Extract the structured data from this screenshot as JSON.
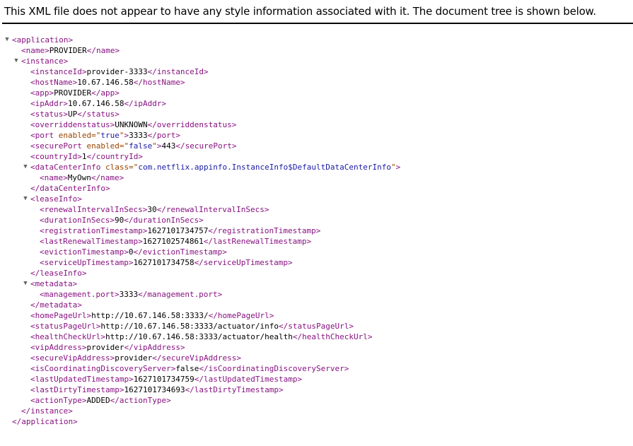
{
  "notice": "This XML file does not appear to have any style information associated with it. The document tree is shown below.",
  "toggle_glyph": "▼",
  "tree": [
    {
      "indent": 0,
      "open": "application",
      "toggle": true
    },
    {
      "indent": 1,
      "open": "name",
      "text": "PROVIDER",
      "close": "name"
    },
    {
      "indent": 1,
      "open": "instance",
      "toggle": true
    },
    {
      "indent": 2,
      "open": "instanceId",
      "text": "provider-3333",
      "close": "instanceId"
    },
    {
      "indent": 2,
      "open": "hostName",
      "text": "10.67.146.58",
      "close": "hostName"
    },
    {
      "indent": 2,
      "open": "app",
      "text": "PROVIDER",
      "close": "app"
    },
    {
      "indent": 2,
      "open": "ipAddr",
      "text": "10.67.146.58",
      "close": "ipAddr"
    },
    {
      "indent": 2,
      "open": "status",
      "text": "UP",
      "close": "status"
    },
    {
      "indent": 2,
      "open": "overriddenstatus",
      "text": "UNKNOWN",
      "close": "overriddenstatus"
    },
    {
      "indent": 2,
      "open": "port",
      "attr": {
        "name": "enabled",
        "value": "true"
      },
      "text": "3333",
      "close": "port"
    },
    {
      "indent": 2,
      "open": "securePort",
      "attr": {
        "name": "enabled",
        "value": "false"
      },
      "text": "443",
      "close": "securePort"
    },
    {
      "indent": 2,
      "open": "countryId",
      "text": "1",
      "close": "countryId"
    },
    {
      "indent": 2,
      "open": "dataCenterInfo",
      "attr": {
        "name": "class",
        "value": "com.netflix.appinfo.InstanceInfo$DefaultDataCenterInfo"
      },
      "toggle": true
    },
    {
      "indent": 3,
      "open": "name",
      "text": "MyOwn",
      "close": "name"
    },
    {
      "indent": 2,
      "close": "dataCenterInfo"
    },
    {
      "indent": 2,
      "open": "leaseInfo",
      "toggle": true
    },
    {
      "indent": 3,
      "open": "renewalIntervalInSecs",
      "text": "30",
      "close": "renewalIntervalInSecs"
    },
    {
      "indent": 3,
      "open": "durationInSecs",
      "text": "90",
      "close": "durationInSecs"
    },
    {
      "indent": 3,
      "open": "registrationTimestamp",
      "text": "1627101734757",
      "close": "registrationTimestamp"
    },
    {
      "indent": 3,
      "open": "lastRenewalTimestamp",
      "text": "1627102574861",
      "close": "lastRenewalTimestamp"
    },
    {
      "indent": 3,
      "open": "evictionTimestamp",
      "text": "0",
      "close": "evictionTimestamp"
    },
    {
      "indent": 3,
      "open": "serviceUpTimestamp",
      "text": "1627101734758",
      "close": "serviceUpTimestamp"
    },
    {
      "indent": 2,
      "close": "leaseInfo"
    },
    {
      "indent": 2,
      "open": "metadata",
      "toggle": true
    },
    {
      "indent": 3,
      "open": "management.port",
      "text": "3333",
      "close": "management.port"
    },
    {
      "indent": 2,
      "close": "metadata"
    },
    {
      "indent": 2,
      "open": "homePageUrl",
      "text": "http://10.67.146.58:3333/",
      "close": "homePageUrl"
    },
    {
      "indent": 2,
      "open": "statusPageUrl",
      "text": "http://10.67.146.58:3333/actuator/info",
      "close": "statusPageUrl"
    },
    {
      "indent": 2,
      "open": "healthCheckUrl",
      "text": "http://10.67.146.58:3333/actuator/health",
      "close": "healthCheckUrl"
    },
    {
      "indent": 2,
      "open": "vipAddress",
      "text": "provider",
      "close": "vipAddress"
    },
    {
      "indent": 2,
      "open": "secureVipAddress",
      "text": "provider",
      "close": "secureVipAddress"
    },
    {
      "indent": 2,
      "open": "isCoordinatingDiscoveryServer",
      "text": "false",
      "close": "isCoordinatingDiscoveryServer"
    },
    {
      "indent": 2,
      "open": "lastUpdatedTimestamp",
      "text": "1627101734759",
      "close": "lastUpdatedTimestamp"
    },
    {
      "indent": 2,
      "open": "lastDirtyTimestamp",
      "text": "1627101734693",
      "close": "lastDirtyTimestamp"
    },
    {
      "indent": 2,
      "open": "actionType",
      "text": "ADDED",
      "close": "actionType"
    },
    {
      "indent": 1,
      "close": "instance"
    },
    {
      "indent": 0,
      "close": "application"
    }
  ]
}
